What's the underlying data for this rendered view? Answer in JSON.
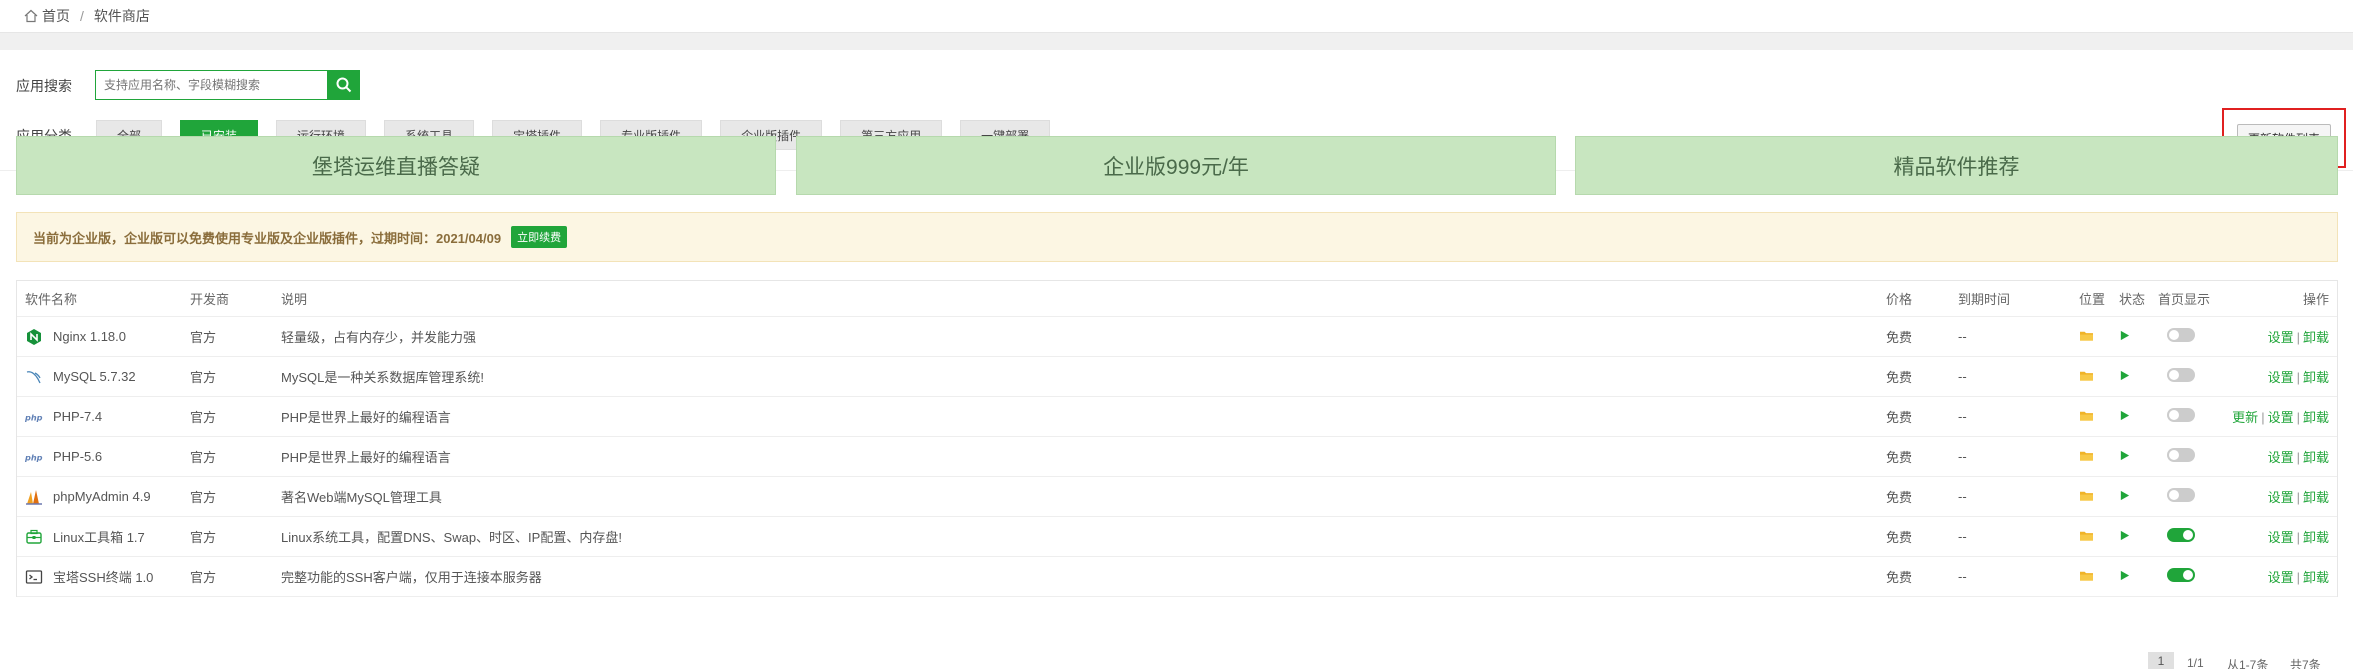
{
  "breadcrumb": {
    "home": "首页",
    "separator": "/",
    "current": "软件商店"
  },
  "search": {
    "label": "应用搜索",
    "placeholder": "支持应用名称、字段模糊搜索"
  },
  "categories": {
    "label": "应用分类",
    "items": [
      "全部",
      "已安装",
      "运行环境",
      "系统工具",
      "宝塔插件",
      "专业版插件",
      "企业版插件",
      "第三方应用",
      "一键部署"
    ],
    "active_index": 1
  },
  "update_button": "更新软件列表",
  "promos": [
    "堡塔运维直播答疑",
    "企业版999元/年",
    "精品软件推荐"
  ],
  "notice": {
    "text": "当前为企业版，企业版可以免费使用专业版及企业版插件，过期时间：2021/04/09",
    "renew": "立即续费"
  },
  "table": {
    "headers": {
      "name": "软件名称",
      "developer": "开发商",
      "desc": "说明",
      "price": "价格",
      "expire": "到期时间",
      "position": "位置",
      "state": "状态",
      "home": "首页显示",
      "ops": "操作"
    },
    "rows": [
      {
        "icon": "nginx-icon",
        "name": "Nginx 1.18.0",
        "developer": "官方",
        "desc": "轻量级，占有内存少，并发能力强",
        "price": "免费",
        "expire": "--",
        "home_on": false,
        "ops": [
          "设置",
          "卸载"
        ]
      },
      {
        "icon": "mysql-icon",
        "name": "MySQL 5.7.32",
        "developer": "官方",
        "desc": "MySQL是一种关系数据库管理系统!",
        "price": "免费",
        "expire": "--",
        "home_on": false,
        "ops": [
          "设置",
          "卸载"
        ]
      },
      {
        "icon": "php-icon",
        "name": "PHP-7.4",
        "developer": "官方",
        "desc": "PHP是世界上最好的编程语言",
        "price": "免费",
        "expire": "--",
        "home_on": false,
        "ops": [
          "更新",
          "设置",
          "卸载"
        ]
      },
      {
        "icon": "php-icon",
        "name": "PHP-5.6",
        "developer": "官方",
        "desc": "PHP是世界上最好的编程语言",
        "price": "免费",
        "expire": "--",
        "home_on": false,
        "ops": [
          "设置",
          "卸载"
        ]
      },
      {
        "icon": "phpmyadmin-icon",
        "name": "phpMyAdmin 4.9",
        "developer": "官方",
        "desc": "著名Web端MySQL管理工具",
        "price": "免费",
        "expire": "--",
        "home_on": false,
        "ops": [
          "设置",
          "卸载"
        ]
      },
      {
        "icon": "toolbox-icon",
        "name": "Linux工具箱 1.7",
        "developer": "官方",
        "desc": "Linux系统工具，配置DNS、Swap、时区、IP配置、内存盘!",
        "price": "免费",
        "expire": "--",
        "home_on": true,
        "ops": [
          "设置",
          "卸载"
        ]
      },
      {
        "icon": "terminal-icon",
        "name": "宝塔SSH终端 1.0",
        "developer": "官方",
        "desc": "完整功能的SSH客户端，仅用于连接本服务器",
        "price": "免费",
        "expire": "--",
        "home_on": true,
        "ops": [
          "设置",
          "卸载"
        ]
      }
    ]
  },
  "pager": {
    "current": "1",
    "pages": "1/1",
    "range": "从1-7条",
    "total": "共7条"
  },
  "colors": {
    "accent": "#20a53a",
    "promo_bg": "#c8e6c0",
    "notice_bg": "#fcf6e3",
    "highlight_border": "#e02020"
  }
}
